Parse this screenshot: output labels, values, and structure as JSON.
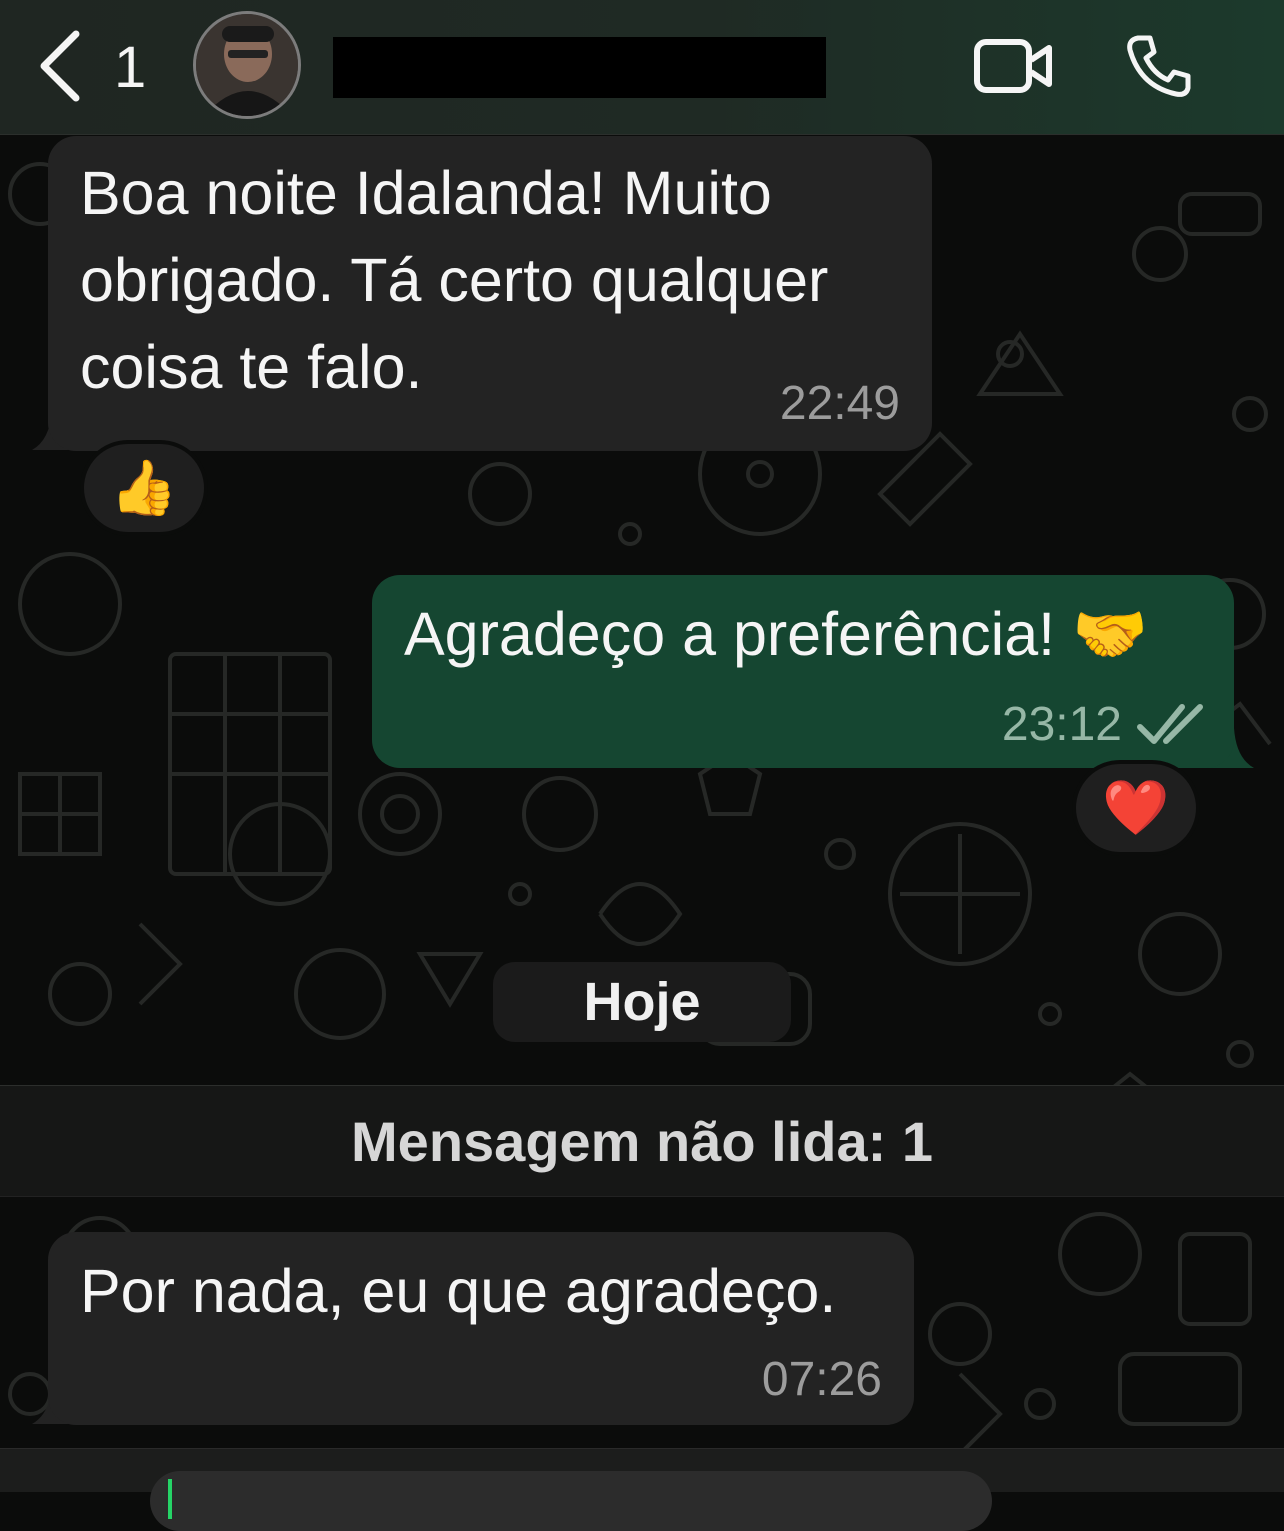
{
  "header": {
    "back_count": "1",
    "contact_name": ""
  },
  "messages": [
    {
      "direction": "incoming",
      "text": "Boa noite Idalanda! Muito\nobrigado. Tá certo qualquer\ncoisa te falo.",
      "time": "22:49",
      "reaction": "👍"
    },
    {
      "direction": "outgoing",
      "text": "Agradeço a preferência! 🤝",
      "time": "23:12",
      "status": "read",
      "reaction": "❤️"
    },
    {
      "direction": "incoming",
      "text": "Por nada, eu que agradeço.",
      "time": "07:26"
    }
  ],
  "date_separator": "Hoje",
  "unread_banner": "Mensagem não lida: 1",
  "colors": {
    "incoming_bubble": "#232323",
    "outgoing_bubble": "#154631",
    "read_ticks": "#96b7a6",
    "background": "#0b0c0b"
  },
  "icons": [
    "back-chevron-icon",
    "video-call-icon",
    "phone-call-icon",
    "double-check-icon"
  ]
}
